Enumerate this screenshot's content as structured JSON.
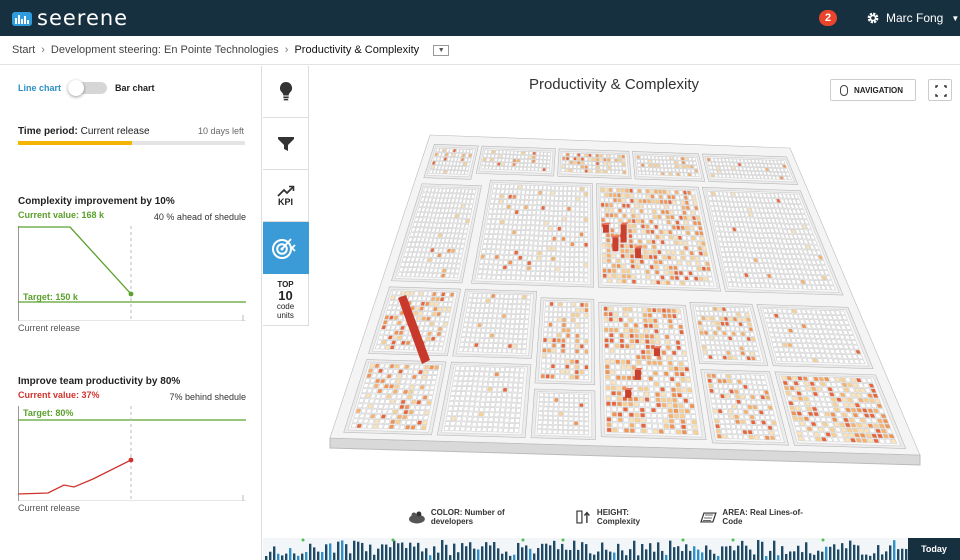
{
  "app": {
    "brand": "seerene"
  },
  "header": {
    "notifications": "2",
    "user_name": "Marc Fong"
  },
  "breadcrumb": {
    "items": [
      "Start",
      "Development steering: En Pointe Technologies",
      "Productivity & Complexity"
    ]
  },
  "left_panel": {
    "toggle": {
      "line_label": "Line chart",
      "bar_label": "Bar chart",
      "selected": "Line chart"
    },
    "time_period": {
      "label": "Time period:",
      "value": "Current release",
      "days_left": "10 days left",
      "progress": 0.5
    },
    "goals": [
      {
        "title": "Complexity improvement by 10%",
        "current_value": "Current value: 168 k",
        "status": "40 % ahead of shedule",
        "target": "Target: 150 k",
        "caption": "Current release",
        "color": "#5aa02c"
      },
      {
        "title": "Improve team productivity by 80%",
        "current_value": "Current value: 37%",
        "status": "7% behind shedule",
        "target": "Target: 80%",
        "caption": "Current release",
        "color": "#d0342c"
      }
    ]
  },
  "side_tabs": {
    "items": [
      {
        "id": "insights",
        "icon": "lightbulb-icon"
      },
      {
        "id": "filter",
        "icon": "filter-icon"
      },
      {
        "id": "kpi",
        "label": "KPI",
        "icon": "trend-icon"
      },
      {
        "id": "goals",
        "icon": "target-icon",
        "active": true
      },
      {
        "id": "top10",
        "label_top": "TOP",
        "label_num": "10",
        "label_sub1": "code",
        "label_sub2": "units"
      }
    ]
  },
  "main": {
    "title": "Productivity & Complexity",
    "navigation_label": "NAVIGATION",
    "legend": {
      "color": "COLOR: Number of developers",
      "height": "HEIGHT: Complexity",
      "area": "AREA: Real Lines-of-Code"
    },
    "today_label": "Today"
  },
  "colors": {
    "topbar": "#17303f",
    "accent": "#3a9bd6",
    "progress": "#f5b400",
    "good": "#5aa02c",
    "bad": "#d0342c"
  }
}
